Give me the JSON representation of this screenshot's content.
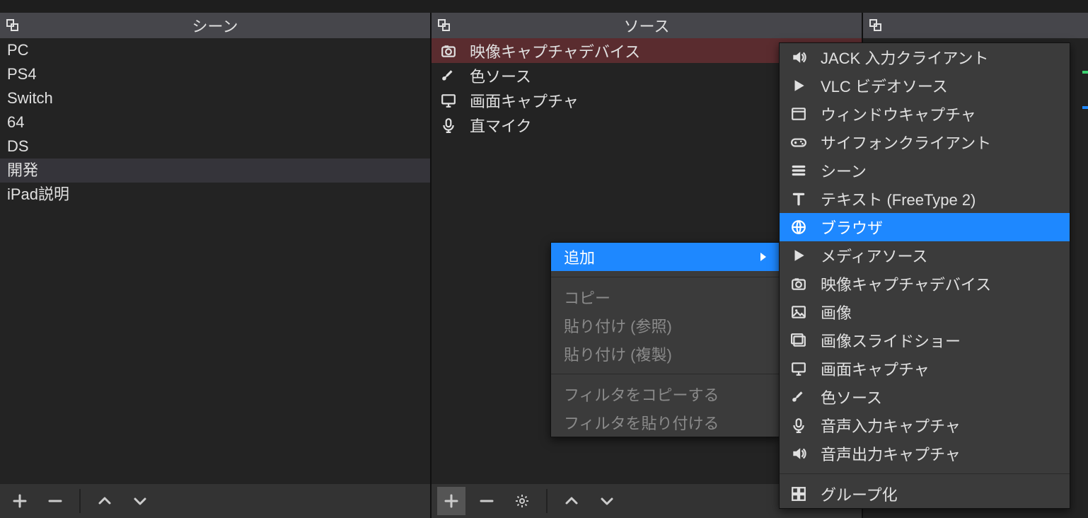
{
  "scenes": {
    "title": "シーン",
    "items": [
      "PC",
      "PS4",
      "Switch",
      "64",
      "DS",
      "開発",
      "iPad説明"
    ],
    "selected_index": 5
  },
  "sources": {
    "title": "ソース",
    "items": [
      {
        "icon": "camera-icon",
        "label": "映像キャプチャデバイス"
      },
      {
        "icon": "brush-icon",
        "label": "色ソース"
      },
      {
        "icon": "monitor-icon",
        "label": "画面キャプチャ"
      },
      {
        "icon": "mic-icon",
        "label": "直マイク"
      }
    ],
    "selected_index": 0
  },
  "mixer": {
    "title": ""
  },
  "context_menu": {
    "items": [
      {
        "label": "追加",
        "type": "submenu",
        "highlight": true
      },
      {
        "type": "sep"
      },
      {
        "label": "コピー",
        "disabled": true
      },
      {
        "label": "貼り付け (参照)",
        "disabled": true
      },
      {
        "label": "貼り付け (複製)",
        "disabled": true
      },
      {
        "type": "sep"
      },
      {
        "label": "フィルタをコピーする",
        "disabled": true
      },
      {
        "label": "フィルタを貼り付ける",
        "disabled": true
      }
    ]
  },
  "add_submenu": {
    "items": [
      {
        "icon": "speaker-icon",
        "label": "JACK 入力クライアント"
      },
      {
        "icon": "play-icon",
        "label": "VLC ビデオソース"
      },
      {
        "icon": "window-icon",
        "label": "ウィンドウキャプチャ"
      },
      {
        "icon": "gamepad-icon",
        "label": "サイフォンクライアント"
      },
      {
        "icon": "list-icon",
        "label": "シーン"
      },
      {
        "icon": "text-icon",
        "label": "テキスト (FreeType 2)"
      },
      {
        "icon": "globe-icon",
        "label": "ブラウザ",
        "highlight": true
      },
      {
        "icon": "play-icon",
        "label": "メディアソース"
      },
      {
        "icon": "camera-icon",
        "label": "映像キャプチャデバイス"
      },
      {
        "icon": "image-icon",
        "label": "画像"
      },
      {
        "icon": "slideshow-icon",
        "label": "画像スライドショー"
      },
      {
        "icon": "monitor-icon",
        "label": "画面キャプチャ"
      },
      {
        "icon": "brush-icon",
        "label": "色ソース"
      },
      {
        "icon": "mic-icon",
        "label": "音声入力キャプチャ"
      },
      {
        "icon": "speaker-icon",
        "label": "音声出力キャプチャ"
      },
      {
        "type": "sep"
      },
      {
        "icon": "group-icon",
        "label": "グループ化"
      }
    ]
  },
  "colors": {
    "accent": "#1e88ff",
    "danger_row": "#5a2c2f"
  }
}
